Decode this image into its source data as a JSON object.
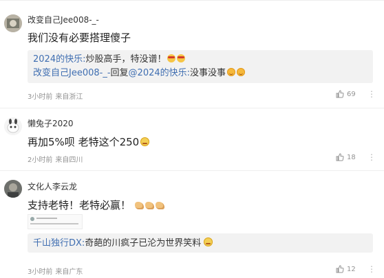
{
  "comments": [
    {
      "username": "改变自己Jee008-_-",
      "content": "我们没有必要搭理傻子",
      "replies": [
        {
          "author": "2024的快乐:",
          "text": "炒股高手，特没谱！"
        },
        {
          "author": "改变自己Jee008-_-",
          "mid": "回复",
          "mention": "@2024的快乐:",
          "text": "没事没事"
        }
      ],
      "time": "3小时前",
      "location": "来自浙江",
      "likes": "69"
    },
    {
      "username": "懒兔子2020",
      "content": "再加5%呗 老特这个250",
      "time": "2小时前",
      "location": "来自四川",
      "likes": "18"
    },
    {
      "username": "文化人李云龙",
      "content": "支持老特！老特必赢！",
      "replies": [
        {
          "author": "千山独行DX:",
          "text": "奇葩的川疯子已沦为世界笑料"
        }
      ],
      "time": "3小时前",
      "location": "来自广东",
      "likes": "12"
    }
  ],
  "icons": {
    "like": "thumb-up-icon",
    "more": "more-icon"
  },
  "colors": {
    "link": "#3f6eb1",
    "meta": "#939393",
    "reply_bg": "#f2f2f2"
  }
}
